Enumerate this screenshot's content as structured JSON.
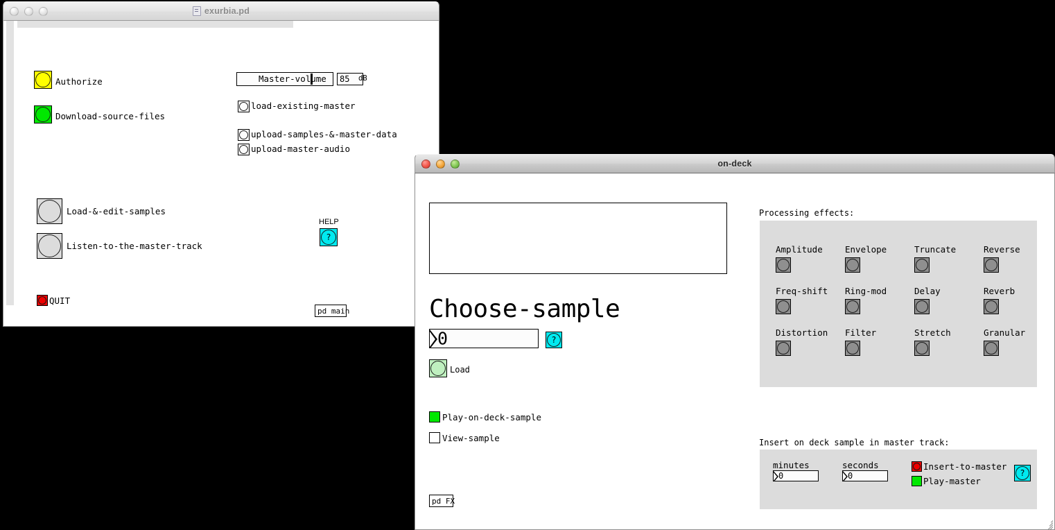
{
  "desktop": {
    "background": "#000000"
  },
  "windows": {
    "main": {
      "title": "exurbia.pd",
      "active": false,
      "bangs": [
        {
          "label": "Authorize",
          "color": "#ffff00"
        },
        {
          "label": "Download-source-files",
          "color": "#00e800"
        }
      ],
      "round_bangs": [
        {
          "label": "Load-&-edit-samples",
          "color": "#dcdcdc"
        },
        {
          "label": "Listen-to-the-master-track",
          "color": "#dcdcdc"
        }
      ],
      "quit": {
        "label": "QUIT",
        "color": "#ee0000"
      },
      "slider": {
        "label": "Master-volume",
        "value": 85,
        "unit": "dB",
        "knob_percent": 77
      },
      "checkbangs": [
        {
          "label": "load-existing-master"
        },
        {
          "label": "upload-samples-&-master-data"
        },
        {
          "label": "upload-master-audio"
        }
      ],
      "help": {
        "label": "HELP",
        "glyph": "?",
        "color": "#00eaf0"
      },
      "subpatch": {
        "label": "pd main"
      }
    },
    "ondeck": {
      "title": "on-deck",
      "active": true,
      "heading": "Choose-sample",
      "sample_index": "0",
      "sample_help": {
        "glyph": "?",
        "color": "#00eaf0"
      },
      "load": {
        "label": "Load",
        "color": "#bff0bf"
      },
      "toggles": [
        {
          "label": "Play-on-deck-sample",
          "color": "#00e800",
          "on": true
        },
        {
          "label": "View-sample",
          "color": "#ffffff",
          "on": false
        }
      ],
      "subpatch": {
        "label": "pd FX"
      },
      "effects_panel": {
        "title": "Processing effects:",
        "effects": [
          "Amplitude",
          "Envelope",
          "Truncate",
          "Reverse",
          "Freq-shift",
          "Ring-mod",
          "Delay",
          "Reverb",
          "Distortion",
          "Filter",
          "Stretch",
          "Granular"
        ],
        "bang_color": "#8f8f8f"
      },
      "insert_panel": {
        "title": "Insert on deck sample in master track:",
        "minutes_label": "minutes",
        "minutes_value": "0",
        "seconds_label": "seconds",
        "seconds_value": "0",
        "insert_to_master": {
          "label": "Insert-to-master",
          "color": "#ee0000"
        },
        "play_master": {
          "label": "Play-master",
          "color": "#00e800"
        },
        "help": {
          "glyph": "?",
          "color": "#00eaf0"
        }
      }
    }
  }
}
